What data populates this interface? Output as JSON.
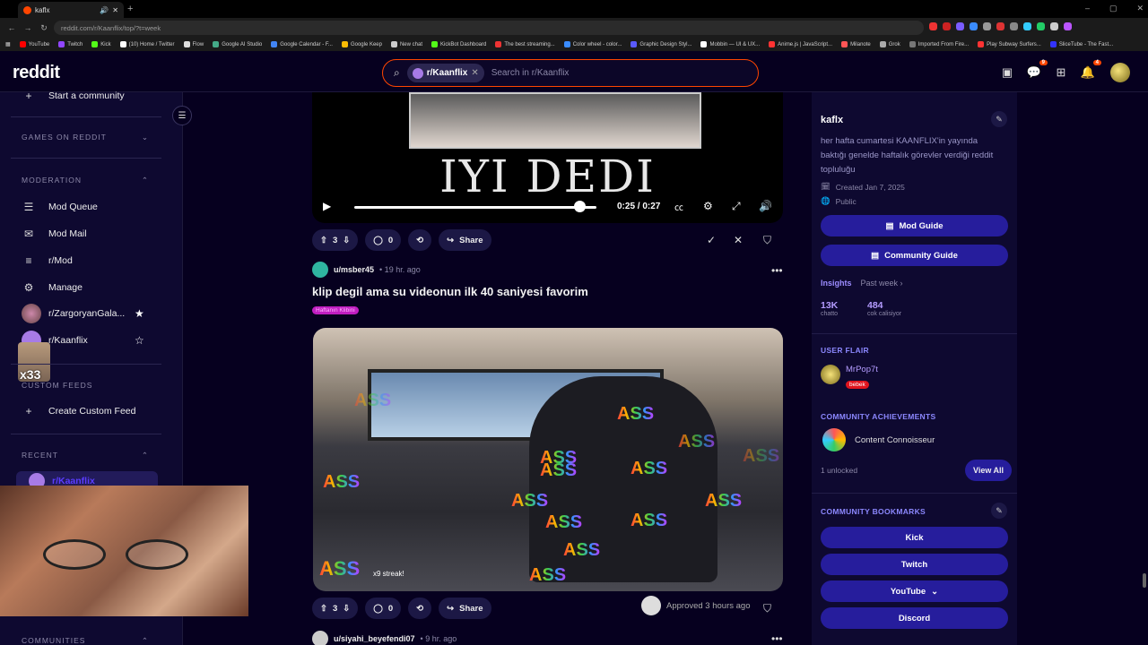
{
  "browser": {
    "tab_title": "kaflx",
    "url": "reddit.com/r/Kaanflix/top/?t=week",
    "bookmarks": [
      "YouTube",
      "Twitch",
      "Kick",
      "(10) Home / Twitter",
      "Flow",
      "Google AI Studio",
      "Google Calendar - F...",
      "Google Keep",
      "New chat",
      "KickBot Dashboard",
      "The best streaming...",
      "Color wheel - color...",
      "Graphic Design Styl...",
      "Mobbin — UI & UX...",
      "Anime.js | JavaScript...",
      "Milanote",
      "Grok",
      "Imported From Fire...",
      "Play Subway Surfers...",
      "SliceTube - The Fast..."
    ]
  },
  "header": {
    "logo": "reddit",
    "search_chip": "r/Kaanflix",
    "search_placeholder": "Search in r/Kaanflix",
    "chat_badge": "9",
    "notif_badge": "4"
  },
  "sidebar": {
    "start_community": "Start a community",
    "games_heading": "GAMES ON REDDIT",
    "moderation_heading": "MODERATION",
    "mod_items": [
      "Mod Queue",
      "Mod Mail",
      "r/Mod",
      "Manage"
    ],
    "subs": [
      "r/ZargoryanGala...",
      "r/Kaanflix"
    ],
    "custom_feeds_heading": "CUSTOM FEEDS",
    "create_custom_feed": "Create Custom Feed",
    "recent_heading": "RECENT",
    "recent_item": "r/Kaanflix",
    "communities_heading": "COMMUNITIES",
    "overlay_cat_text": "x33"
  },
  "post1": {
    "video_caption": "IYI DEDI",
    "time": "0:25 / 0:27",
    "progress": 0.93,
    "votes": "3",
    "comments": "0",
    "share": "Share"
  },
  "post2": {
    "author": "u/msber45",
    "age": "• 19 hr. ago",
    "title": "klip degil ama su videonun ilk 40 saniyesi favorim",
    "flair": "Haftanın Klibini",
    "overlay_word": "ASS",
    "streak": "x9 streak!",
    "votes": "3",
    "comments": "0",
    "share": "Share",
    "approved": "Approved 3 hours ago"
  },
  "post3": {
    "author": "u/siyahi_beyefendi07",
    "age": "• 9 hr. ago"
  },
  "right_sidebar": {
    "title": "kaflx",
    "description": "her hafta cumartesi KAANFLIX'in yayında baktığı genelde haftalık görevler verdiği reddit topluluğu",
    "created": "Created Jan 7, 2025",
    "visibility": "Public",
    "mod_guide": "Mod Guide",
    "community_guide": "Community Guide",
    "insights": "Insights",
    "insights_period": "Past week ›",
    "stats": [
      {
        "value": "13K",
        "label": "chatto"
      },
      {
        "value": "484",
        "label": "cok calisiyor"
      }
    ],
    "user_flair_heading": "USER FLAIR",
    "flair_user": "MrPop7t",
    "flair_tag": "bebek",
    "achievements_heading": "COMMUNITY ACHIEVEMENTS",
    "achievement": "Content Connoisseur",
    "unlocked": "1 unlocked",
    "view_all": "View All",
    "bookmarks_heading": "COMMUNITY BOOKMARKS",
    "bookmark_buttons": [
      "Kick",
      "Twitch",
      "YouTube",
      "Discord"
    ]
  },
  "colors": {
    "accent": "#ff4500",
    "button": "#261d9c",
    "bg": "#06001f"
  }
}
